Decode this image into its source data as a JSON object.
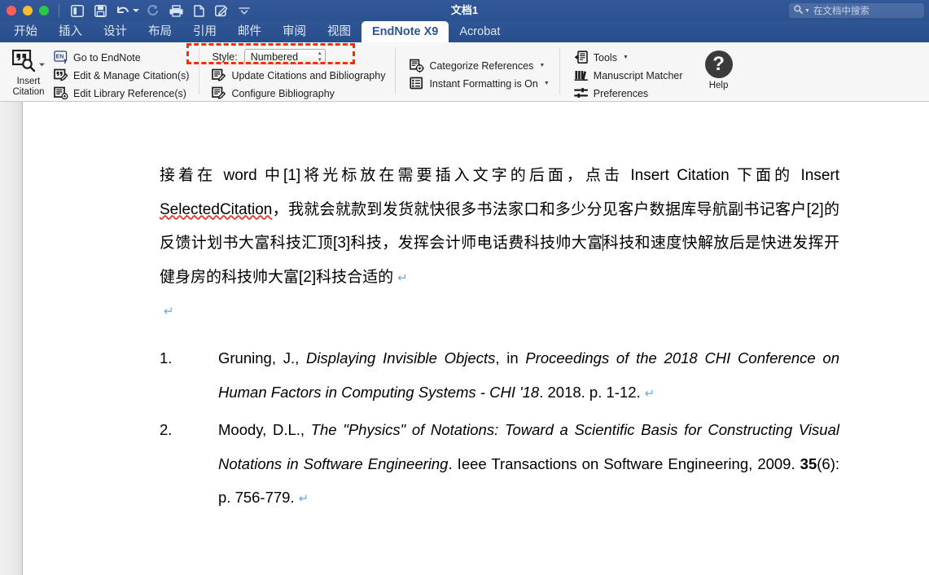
{
  "titlebar": {
    "document_title": "文档1",
    "quick_access": [
      {
        "name": "sidebar-toggle-icon",
        "label": "Sidebar"
      },
      {
        "name": "save-icon",
        "label": "Save"
      },
      {
        "name": "undo-icon",
        "label": "Undo"
      },
      {
        "name": "redo-icon",
        "label": "Redo"
      },
      {
        "name": "print-icon",
        "label": "Print"
      },
      {
        "name": "new-document-icon",
        "label": "New"
      },
      {
        "name": "track-changes-icon",
        "label": "Track Changes"
      },
      {
        "name": "customize-toolbar-icon",
        "label": "Customize"
      }
    ],
    "search_placeholder": "在文档中搜索"
  },
  "tabs": [
    {
      "label": "开始",
      "active": false
    },
    {
      "label": "插入",
      "active": false
    },
    {
      "label": "设计",
      "active": false
    },
    {
      "label": "布局",
      "active": false
    },
    {
      "label": "引用",
      "active": false
    },
    {
      "label": "邮件",
      "active": false
    },
    {
      "label": "审阅",
      "active": false
    },
    {
      "label": "视图",
      "active": false
    },
    {
      "label": "EndNote X9",
      "active": true
    },
    {
      "label": "Acrobat",
      "active": false
    }
  ],
  "ribbon": {
    "insert_citation": {
      "line1": "Insert",
      "line2": "Citation"
    },
    "citations_menu": [
      {
        "label": "Go to EndNote",
        "icon": "endnote-icon",
        "dropdown": false
      },
      {
        "label": "Edit & Manage Citation(s)",
        "icon": "edit-citation-icon",
        "dropdown": false
      },
      {
        "label": "Edit Library Reference(s)",
        "icon": "edit-library-icon",
        "dropdown": false
      }
    ],
    "bibliography": {
      "style_label": "Style:",
      "style_value": "Numbered",
      "items": [
        {
          "label": "Update Citations and Bibliography",
          "icon": "update-bibliography-icon"
        },
        {
          "label": "Configure Bibliography",
          "icon": "configure-bibliography-icon"
        }
      ]
    },
    "middle_items": [
      {
        "label": "Categorize References",
        "icon": "categorize-references-icon",
        "dropdown": true
      },
      {
        "label": "Instant Formatting is On",
        "icon": "instant-formatting-icon",
        "dropdown": true
      }
    ],
    "tools_items": [
      {
        "label": "Tools",
        "icon": "tools-icon",
        "dropdown": true
      },
      {
        "label": "Manuscript Matcher",
        "icon": "manuscript-matcher-icon",
        "dropdown": false
      },
      {
        "label": "Preferences",
        "icon": "preferences-icon",
        "dropdown": false
      }
    ],
    "help": {
      "label": "Help",
      "glyph": "?"
    },
    "annotation_color": "#ff2a00"
  },
  "document": {
    "paragraph": {
      "run1": "接着在 word 中[1]将光标放在需要插入文字的后面，点击 Insert  Citation 下面的 Insert ",
      "run_misspelled": "SelectedCitation",
      "run2": "，我就会就款到发货就快很多书法家口和多少分见客户数据库导航副书记客户[2]的反馈计划书大富科技汇顶[3]科技，发挥会计师电话费科技帅大富",
      "run3": "科技和速度快解放后是快进发挥开健身房的科技帅大富[2]科技合适的",
      "pilcrow": "↵"
    },
    "blank_pilcrow": "↵",
    "bibliography": [
      {
        "number": "1.",
        "author": "Gruning, J., ",
        "title": "Displaying Invisible Objects",
        "mid": ", in ",
        "source": "Proceedings of the 2018 CHI Conference on Human Factors in Computing Systems - CHI '18",
        "tail": ". 2018. p. 1-12.",
        "volume": "",
        "pilcrow": "↵"
      },
      {
        "number": "2.",
        "author": "Moody, D.L., ",
        "title": "The \"Physics\" of Notations: Toward a Scientific Basis for Constructing Visual Notations in Software Engineering",
        "mid": "",
        "source": "",
        "tail": ". Ieee Transactions on Software Engineering, 2009. ",
        "volume": "35",
        "tail2": "(6): p. 756-779.",
        "pilcrow": "↵"
      }
    ]
  }
}
